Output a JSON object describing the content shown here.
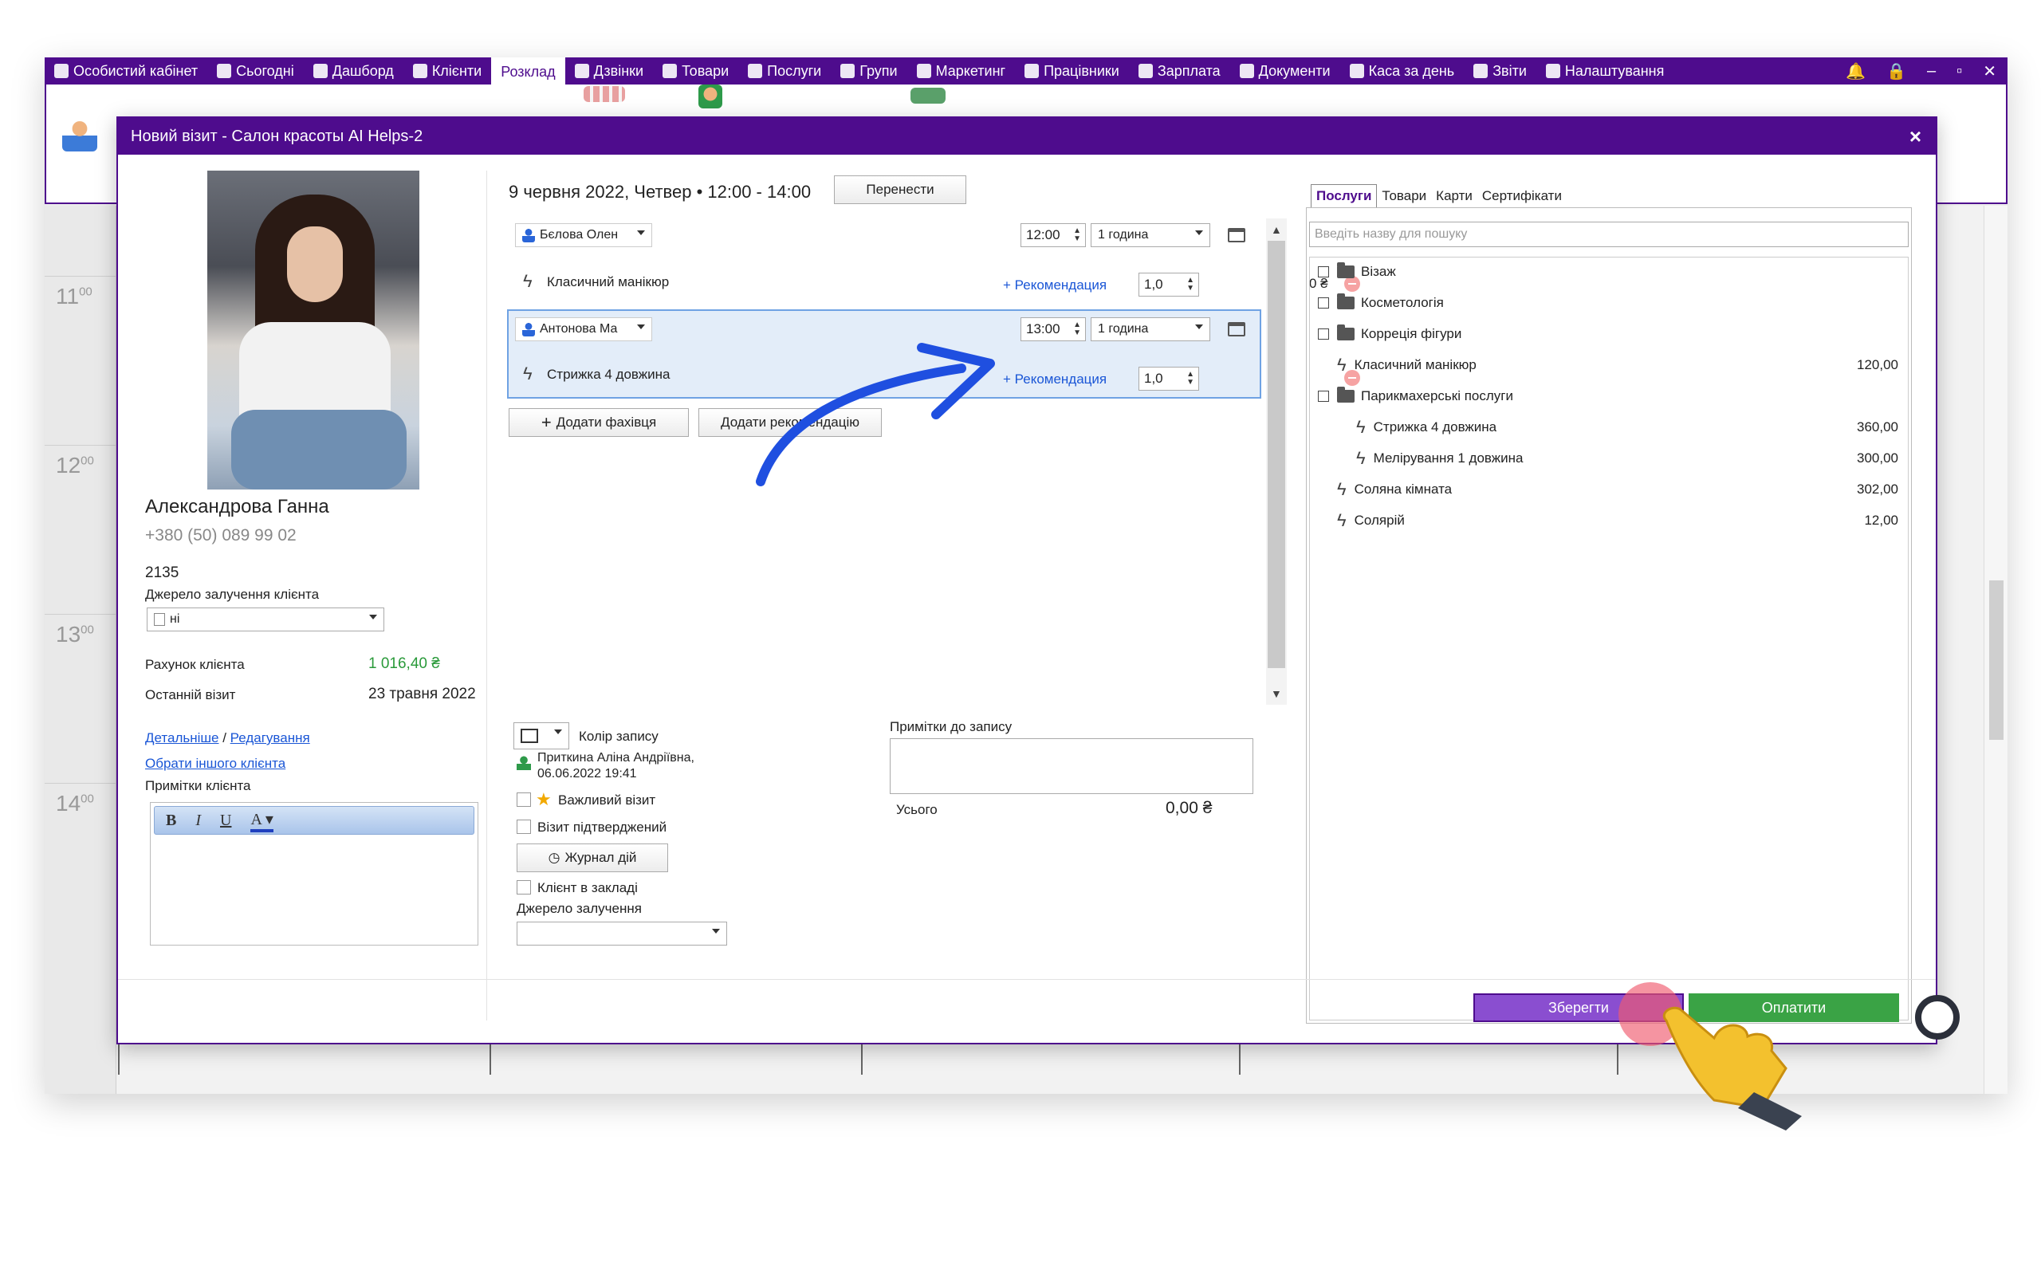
{
  "nav": {
    "items": [
      {
        "label": "Особистий кабінет",
        "icon": "cabinet-icon"
      },
      {
        "label": "Сьогодні",
        "icon": "today-icon"
      },
      {
        "label": "Дашборд",
        "icon": "dashboard-icon"
      },
      {
        "label": "Клієнти",
        "icon": "clients-icon"
      },
      {
        "label": "Розклад",
        "icon": "schedule-icon"
      },
      {
        "label": "Дзвінки",
        "icon": "calls-icon"
      },
      {
        "label": "Товари",
        "icon": "goods-icon"
      },
      {
        "label": "Послуги",
        "icon": "services-icon"
      },
      {
        "label": "Групи",
        "icon": "groups-icon"
      },
      {
        "label": "Маркетинг",
        "icon": "marketing-icon"
      },
      {
        "label": "Працівники",
        "icon": "employees-icon"
      },
      {
        "label": "Зарплата",
        "icon": "salary-icon"
      },
      {
        "label": "Документи",
        "icon": "documents-icon"
      },
      {
        "label": "Каса за день",
        "icon": "cashdesk-icon"
      },
      {
        "label": "Звіти",
        "icon": "reports-icon"
      },
      {
        "label": "Налаштування",
        "icon": "settings-icon"
      }
    ],
    "active": "Розклад",
    "win_minimize": "–",
    "win_restore": "▫",
    "win_close": "✕"
  },
  "calendar": {
    "times": [
      {
        "hour": "11",
        "min": "00"
      },
      {
        "hour": "12",
        "min": "00"
      },
      {
        "hour": "13",
        "min": "00"
      },
      {
        "hour": "14",
        "min": "00"
      }
    ]
  },
  "modal": {
    "title": "Новий візит - Салон красоты AI Helps-2",
    "close": "×"
  },
  "client": {
    "name": "Александрова Ганна",
    "phone": "+380 (50) 089 99 02",
    "card": "2135",
    "source_label": "Джерело залучення клієнта",
    "source_value": "ні",
    "balance_label": "Рахунок клієнта",
    "balance_value": "1 016,40 ₴",
    "last_visit_label": "Останній візит",
    "last_visit_value": "23 травня 2022",
    "link_details": "Детальніше",
    "link_sep": " / ",
    "link_edit": "Редагування",
    "link_other": "Обрати іншого клієнта",
    "notes_label": "Примітки клієнта",
    "rte": {
      "bold": "B",
      "italic": "I",
      "underline": "U",
      "color": "A"
    }
  },
  "visit": {
    "datetime": "9 червня 2022, Четвер • 12:00 - 14:00",
    "move_button": "Перенести",
    "rows": [
      {
        "master": "Бєлова Олен",
        "time": "12:00",
        "duration": "1 година",
        "service": "Класичний манікюр",
        "reco": "+ Рекомендация",
        "qty": "1,0",
        "price": "0 ₴"
      },
      {
        "master": "Антонова Ма",
        "time": "13:00",
        "duration": "1 година",
        "service": "Стрижка 4 довжина",
        "reco": "+ Рекомендация",
        "qty": "1,0",
        "price": ""
      }
    ],
    "add_specialist": "Додати фахівця",
    "add_recommendation": "Додати рекомендацію",
    "color_label": "Колір запису",
    "created_by": "Приткина Аліна Андріївна,",
    "created_at": "06.06.2022 19:41",
    "important": "Важливий візит",
    "confirmed": "Візит підтверджений",
    "journal": "Журнал дій",
    "in_salon": "Клієнт в закладі",
    "source_label": "Джерело залучення",
    "notes_label": "Примітки до запису",
    "total_label": "Усього",
    "total_value": "0,00 ₴"
  },
  "services": {
    "tabs": [
      "Послуги",
      "Товари",
      "Карти",
      "Сертифікати"
    ],
    "search_placeholder": "Введіть назву для пошуку",
    "tree": [
      {
        "label": "Візаж",
        "type": "folder",
        "level": 0,
        "price": ""
      },
      {
        "label": "Косметологія",
        "type": "folder",
        "level": 0,
        "price": ""
      },
      {
        "label": "Корреція фігури",
        "type": "folder",
        "level": 0,
        "price": ""
      },
      {
        "label": "Класичний манікюр",
        "type": "service",
        "level": 1,
        "price": "120,00"
      },
      {
        "label": "Парикмахерські послуги",
        "type": "folder",
        "level": 0,
        "price": ""
      },
      {
        "label": "Стрижка 4 довжина",
        "type": "service",
        "level": 2,
        "price": "360,00"
      },
      {
        "label": "Мелірування 1 довжина",
        "type": "service",
        "level": 2,
        "price": "300,00"
      },
      {
        "label": "Соляна кімната",
        "type": "service",
        "level": 1,
        "price": "302,00"
      },
      {
        "label": "Солярій",
        "type": "service",
        "level": 1,
        "price": "12,00"
      }
    ]
  },
  "footer": {
    "save": "Зберегти",
    "pay": "Оплатити"
  },
  "colors": {
    "brand": "#4e0c8d",
    "save": "#8a4ed0",
    "pay": "#3aa345",
    "link": "#1a56d6",
    "arrow": "#1f4fe0"
  }
}
